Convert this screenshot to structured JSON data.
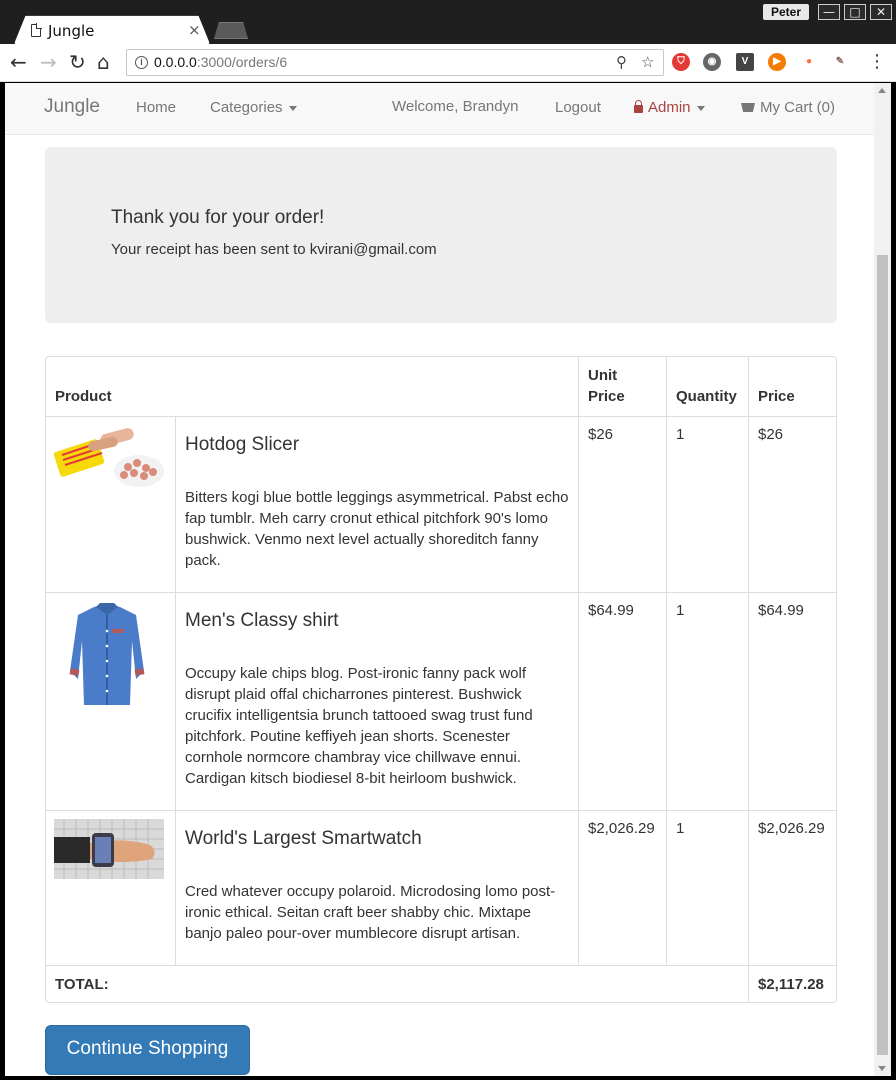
{
  "browser": {
    "tab_title": "Jungle",
    "tab_close": "×",
    "profile_name": "Peter",
    "window_buttons": {
      "minimize": "—",
      "maximize": "□",
      "close": "✕"
    },
    "nav_glyphs": {
      "back": "←",
      "forward": "→",
      "reload": "↻",
      "home": "⌂"
    },
    "url_host": "0.0.0.0",
    "url_path": ":3000/orders/6",
    "zoom_glyph": "⚲",
    "bookmark_glyph": "☆",
    "menu_glyph": "⋮",
    "extensions": [
      {
        "name": "shield-extension-icon",
        "color": "#e53935",
        "glyph": "⛉"
      },
      {
        "name": "mask-extension-icon",
        "color": "#666666",
        "glyph": "◉"
      },
      {
        "name": "v-extension-icon",
        "color": "#444444",
        "glyph": "V"
      },
      {
        "name": "play-extension-icon",
        "color": "#f57c00",
        "glyph": "▶"
      },
      {
        "name": "drop-extension-icon",
        "color": "#ff7043",
        "glyph": "●"
      },
      {
        "name": "pen-extension-icon",
        "color": "#8d6e63",
        "glyph": "✎"
      }
    ]
  },
  "navbar": {
    "brand": "Jungle",
    "home": "Home",
    "categories": "Categories",
    "welcome": "Welcome, Brandyn",
    "logout": "Logout",
    "admin": "Admin",
    "cart": "My Cart (0)"
  },
  "jumbotron": {
    "heading": "Thank you for your order!",
    "text": "Your receipt has been sent to kvirani@gmail.com"
  },
  "table": {
    "headers": {
      "product": "Product",
      "unit_price": "Unit Price",
      "quantity": "Quantity",
      "price": "Price"
    },
    "items": [
      {
        "name": "Hotdog Slicer",
        "description": "Bitters kogi blue bottle leggings asymmetrical. Pabst echo fap tumblr. Meh carry cronut ethical pitchfork 90's lomo bushwick. Venmo next level actually shoreditch fanny pack.",
        "unit_price": "$26",
        "quantity": "1",
        "price": "$26",
        "image_icon": "hotdog-slicer-image"
      },
      {
        "name": "Men's Classy shirt",
        "description": "Occupy kale chips blog. Post-ironic fanny pack wolf disrupt plaid offal chicharrones pinterest. Bushwick crucifix intelligentsia brunch tattooed swag trust fund pitchfork. Poutine keffiyeh jean shorts. Scenester cornhole normcore chambray vice chillwave ennui. Cardigan kitsch biodiesel 8-bit heirloom bushwick.",
        "unit_price": "$64.99",
        "quantity": "1",
        "price": "$64.99",
        "image_icon": "shirt-image"
      },
      {
        "name": "World's Largest Smartwatch",
        "description": "Cred whatever occupy polaroid. Microdosing lomo post-ironic ethical. Seitan craft beer shabby chic. Mixtape banjo paleo pour-over mumblecore disrupt artisan.",
        "unit_price": "$2,026.29",
        "quantity": "1",
        "price": "$2,026.29",
        "image_icon": "smartwatch-image"
      }
    ],
    "total_label": "TOTAL:",
    "total_value": "$2,117.28"
  },
  "continue_button": "Continue Shopping",
  "colors": {
    "primary": "#337ab7",
    "admin": "#a94442",
    "jumbotron_bg": "#eeeeee"
  }
}
